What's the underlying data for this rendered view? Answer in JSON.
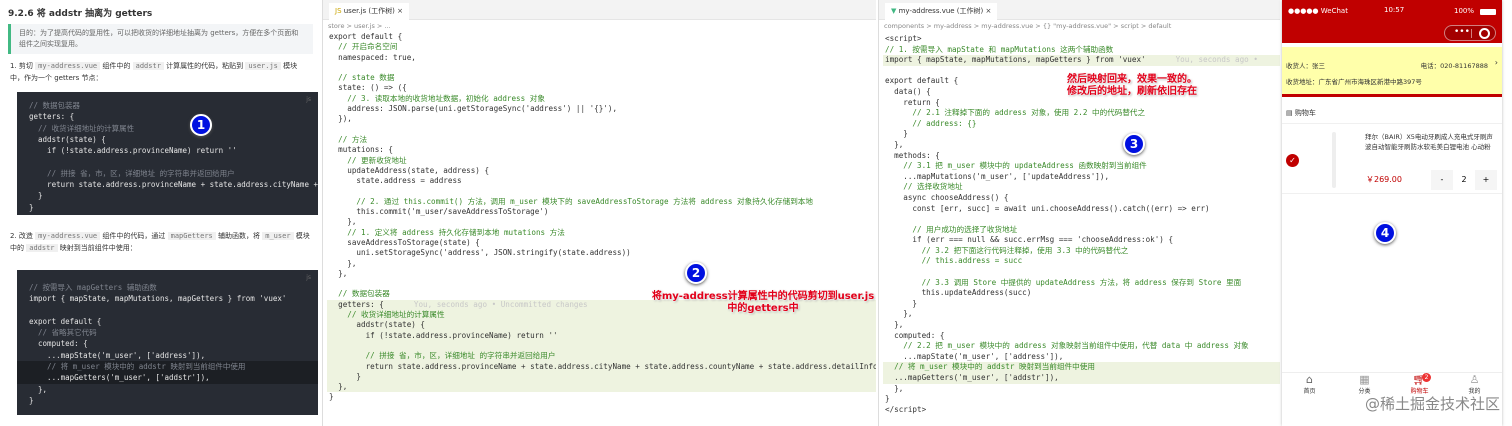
{
  "doc": {
    "heading": "9.2.6 将 addstr 抽离为 getters",
    "quote": "目的：为了提高代码的复用性，可以把收货的详细地址抽离为 getters，方便在多个页面和组件之间实现复用。",
    "step1": {
      "a": "1. 剪切",
      "c1": "my-address.vue",
      "b": "组件中的",
      "c2": "addstr",
      "d": "计算属性的代码，粘贴到",
      "c3": "user.js",
      "e": "模块中，作为一个 getters 节点："
    },
    "code1_lang": "js",
    "code1": [
      {
        "t": "// 数据包装器",
        "c": 1
      },
      {
        "t": "getters: {"
      },
      {
        "t": "  // 收货详细地址的计算属性",
        "c": 1
      },
      {
        "t": "  addstr(state) {"
      },
      {
        "t": "    if (!state.address.provinceName) return ''"
      },
      {
        "t": ""
      },
      {
        "t": "    // 拼接 省，市，区，详细地址 的字符串并返回给用户",
        "c": 1
      },
      {
        "t": "    return state.address.provinceName + state.address.cityName + state.address.countyName + state.address.detailInfo"
      },
      {
        "t": "  }"
      },
      {
        "t": "}"
      }
    ],
    "step2": {
      "a": "2. 改造",
      "c1": "my-address.vue",
      "b": "组件中的代码，通过",
      "c2": "mapGetters",
      "d": "辅助函数，将",
      "c3": "m_user",
      "e": "模块中的",
      "c4": "addstr",
      "f": "映射到当前组件中使用："
    },
    "code2_lang": "js",
    "code2": [
      {
        "t": "// 按需导入 mapGetters 辅助函数",
        "c": 1
      },
      {
        "t": "import { mapState, mapMutations, mapGetters } from 'vuex'"
      },
      {
        "t": ""
      },
      {
        "t": "export default {"
      },
      {
        "t": "  // 省略其它代码",
        "c": 1
      },
      {
        "t": "  computed: {"
      },
      {
        "t": "    ...mapState('m_user', ['address']),"
      },
      {
        "t": "    // 将 m_user 模块中的 addstr 映射到当前组件中使用",
        "c": 1,
        "h": 1
      },
      {
        "t": "    ...mapGetters('m_user', ['addstr']),",
        "h": 1
      },
      {
        "t": "  },"
      },
      {
        "t": "}"
      }
    ]
  },
  "editor1": {
    "tab": "user.js (工作树)",
    "breadcrumb": "store > user.js > ...",
    "lines": [
      {
        "t": "export default {"
      },
      {
        "t": "  // 开启命名空间",
        "c": 1
      },
      {
        "t": "  namespaced: true,"
      },
      {
        "t": ""
      },
      {
        "t": "  // state 数据",
        "c": 1
      },
      {
        "t": "  state: () => ({"
      },
      {
        "t": "    // 3. 读取本地的收货地址数据，初始化 address 对象",
        "c": 1
      },
      {
        "t": "    address: JSON.parse(uni.getStorageSync('address') || '{}'),"
      },
      {
        "t": "  }),"
      },
      {
        "t": ""
      },
      {
        "t": "  // 方法",
        "c": 1
      },
      {
        "t": "  mutations: {"
      },
      {
        "t": "    // 更新收货地址",
        "c": 1
      },
      {
        "t": "    updateAddress(state, address) {"
      },
      {
        "t": "      state.address = address"
      },
      {
        "t": ""
      },
      {
        "t": "      // 2. 通过 this.commit() 方法，调用 m_user 模块下的 saveAddressToStorage 方法将 address 对象持久化存储到本地",
        "c": 1
      },
      {
        "t": "      this.commit('m_user/saveAddressToStorage')"
      },
      {
        "t": "    },"
      },
      {
        "t": "    // 1. 定义将 address 持久化存储到本地 mutations 方法",
        "c": 1
      },
      {
        "t": "    saveAddressToStorage(state) {"
      },
      {
        "t": "      uni.setStorageSync('address', JSON.stringify(state.address))"
      },
      {
        "t": "    },"
      },
      {
        "t": "  },"
      },
      {
        "t": ""
      },
      {
        "t": "  // 数据包装器",
        "c": 1
      },
      {
        "t": "  getters: {",
        "h": 1,
        "b": "You, seconds ago • Uncommitted changes"
      },
      {
        "t": "    // 收货详细地址的计算属性",
        "c": 1,
        "h": 1
      },
      {
        "t": "      addstr(state) {",
        "h": 1
      },
      {
        "t": "        if (!state.address.provinceName) return ''",
        "h": 1
      },
      {
        "t": "",
        "h": 1
      },
      {
        "t": "        // 拼接 省，市，区，详细地址 的字符串并返回给用户",
        "c": 1,
        "h": 1
      },
      {
        "t": "        return state.address.provinceName + state.address.cityName + state.address.countyName + state.address.detailInfo",
        "h": 1
      },
      {
        "t": "      }",
        "h": 1
      },
      {
        "t": "  },",
        "h": 1
      },
      {
        "t": "}"
      }
    ],
    "note": "将my-address计算属性中的代码剪切到user.js中的getters中"
  },
  "editor2": {
    "tab": "my-address.vue (工作树)",
    "breadcrumb": "components > my-address > my-address.vue > {} \"my-address.vue\" > script > default",
    "lines": [
      {
        "t": "<script>"
      },
      {
        "t": "// 1. 按需导入 mapState 和 mapMutations 这两个辅助函数",
        "c": 1
      },
      {
        "t": "import { mapState, mapMutations, mapGetters } from 'vuex'",
        "h": 1,
        "b": "You, seconds ago •"
      },
      {
        "t": ""
      },
      {
        "t": "export default {"
      },
      {
        "t": "  data() {"
      },
      {
        "t": "    return {"
      },
      {
        "t": "      // 2.1 注释掉下面的 address 对象，使用 2.2 中的代码替代之",
        "c": 1
      },
      {
        "t": "      // address: {}",
        "c": 1
      },
      {
        "t": "    }"
      },
      {
        "t": "  },"
      },
      {
        "t": "  methods: {"
      },
      {
        "t": "    // 3.1 把 m_user 模块中的 updateAddress 函数映射到当前组件",
        "c": 1
      },
      {
        "t": "    ...mapMutations('m_user', ['updateAddress']),"
      },
      {
        "t": "    // 选择收货地址",
        "c": 1
      },
      {
        "t": "    async chooseAddress() {"
      },
      {
        "t": "      const [err, succ] = await uni.chooseAddress().catch((err) => err)"
      },
      {
        "t": ""
      },
      {
        "t": "      // 用户成功的选择了收货地址",
        "c": 1
      },
      {
        "t": "      if (err === null && succ.errMsg === 'chooseAddress:ok') {"
      },
      {
        "t": "        // 3.2 把下面这行代码注释掉，使用 3.3 中的代码替代之",
        "c": 1
      },
      {
        "t": "        // this.address = succ",
        "c": 1
      },
      {
        "t": ""
      },
      {
        "t": "        // 3.3 调用 Store 中提供的 updateAddress 方法，将 address 保存到 Store 里面",
        "c": 1
      },
      {
        "t": "        this.updateAddress(succ)"
      },
      {
        "t": "      }"
      },
      {
        "t": "    },"
      },
      {
        "t": "  },"
      },
      {
        "t": "  computed: {"
      },
      {
        "t": "    // 2.2 把 m_user 模块中的 address 对象映射当前组件中使用，代替 data 中 address 对象",
        "c": 1
      },
      {
        "t": "    ...mapState('m_user', ['address']),"
      },
      {
        "t": "  // 将 m_user 模块中的 addstr 映射到当前组件中使用",
        "c": 1,
        "h": 1
      },
      {
        "t": "  ...mapGetters('m_user', ['addstr']),",
        "h": 1
      },
      {
        "t": "  },"
      },
      {
        "t": "}"
      },
      {
        "t": "</script>"
      }
    ],
    "note_line1": "然后映射回来，效果一致的。",
    "note_line2": "修改后的地址，刷新依旧存在"
  },
  "badges": [
    "1",
    "2",
    "3",
    "4"
  ],
  "phone": {
    "carrier": "●●●●● WeChat",
    "time": "10:57",
    "battery": "100%",
    "receiver_label": "收货人：张三",
    "phone_label": "电话：020-81167888",
    "address_label": "收货地址：广东省广州市海珠区新港中路397号",
    "cart_title": "购物车",
    "product_name": "拜尔（BAIR）X5电动牙刷成人充电式牙刷声波自动智能牙刷防水软毛美白锂电池 心动粉",
    "price": "￥269.00",
    "quantity": "2",
    "minus": "-",
    "plus": "+",
    "tabs": [
      "首页",
      "分类",
      "购物车",
      "我的"
    ],
    "cart_badge": "2",
    "brand_color": "#c00000"
  },
  "watermark": "@稀土掘金技术社区"
}
